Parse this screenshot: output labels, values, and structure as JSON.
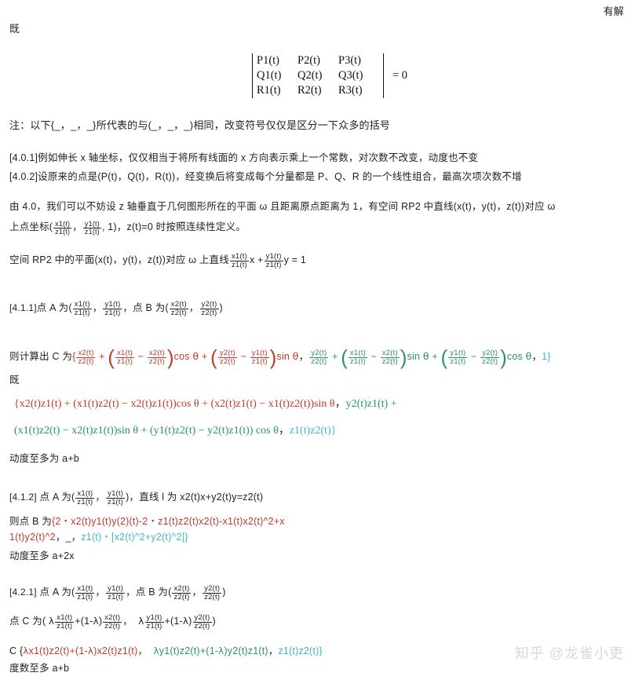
{
  "document": {
    "top_right_note": "有解",
    "left_note_1": "既",
    "left_note_2": "既"
  },
  "determinant": {
    "rows": [
      [
        "P1(t)",
        "P2(t)",
        "P3(t)"
      ],
      [
        "Q1(t)",
        "Q2(t)",
        "Q3(t)"
      ],
      [
        "R1(t)",
        "R2(t)",
        "R3(t)"
      ]
    ],
    "equals": "= 0"
  },
  "paragraphs": {
    "note_brackets": "注：以下{_，_，_}所代表的与(_，_，_)相同，改变符号仅仅是区分一下众多的括号",
    "item_401": "[4.0.1]例如伸长 x 轴坐标，仅仅相当于将所有线面的 x 方向表示乘上一个常数，对次数不改变，动度也不变",
    "item_402": "[4.0.2]设原来的点是(P(t)，Q(t)，R(t))，经变换后将变成每个分量都是 P、Q、R 的一个线性组合，最高次项次数不增",
    "para_40_line1_a": "由 4.0，我们可以不妨设 z 轴垂直于几何图形所在的平面 ω 且距离原点距离为 1，有空间 RP2 中直线(x(t)，y(t)，z(t))对应 ω",
    "para_40_line2_a": "上点坐标(",
    "para_40_line2_b": "，",
    "para_40_line2_c": ", 1)，z(t)=0 时按照连续性定义。",
    "plane_line_a": "空间 RP2 中的平面(x(t)，y(t)，z(t))对应 ω 上直线",
    "plane_line_b": "x +",
    "plane_line_c": "y = 1"
  },
  "section_411": {
    "tag": "[4.1.1]",
    "point_a_label": "点 A 为(",
    "comma": "，",
    "point_b_label": "，点 B 为(",
    "close": ")",
    "frac_x1z1": {
      "num": "x1(t)",
      "den": "z1(t)"
    },
    "frac_y1z1": {
      "num": "y1(t)",
      "den": "z1(t)"
    },
    "frac_x2z2": {
      "num": "x2(t)",
      "den": "z2(t)"
    },
    "frac_y2z2": {
      "num": "y2(t)",
      "den": "z2(t)"
    },
    "result_prefix": "则计算出 C 为",
    "brace_open": "{",
    "minus": "−",
    "plus": "+",
    "cos": "cos",
    "sin": "sin",
    "theta": "θ",
    "comma_sep": "，",
    "tail_one": "1}",
    "below_note": "既"
  },
  "expanded_411": {
    "line1": "{x2(t)z1(t) + (x1(t)z2(t) − x2(t)z1(t))cos θ + (x2(t)z1(t) − x1(t)z2(t))sin θ",
    "line1_green": "y2(t)z1(t) +",
    "line2_green": "(x1(t)z2(t) − x2(t)z1(t))sin θ + (y1(t)z2(t) − y2(t)z1(t)) cos θ",
    "line2_teal": "z1(t)z2(t)}",
    "degree_note": "动度至多为 a+b"
  },
  "section_412": {
    "tag": "[4.1.2]",
    "point_a_label": "点 A 为(",
    "comma": "，",
    "line_label": "，直线 l 为 x2(t)x+y2(t)y=z2(t)",
    "point_b_prefix": "则点 B 为",
    "b_red_line1": "{2・x2(t)y1(t)y(2)(t)-2・z1(t)z2(t)x2(t)-x1(t)x2(t)^2+x",
    "b_red_line2": "1(t)y2(t)^2",
    "b_sep1": "，_，",
    "b_teal": "z1(t)・[x2(t)^2+y2(t)^2]}",
    "degree_note": "动度至多 a+2x"
  },
  "section_421": {
    "tag": "[4.2.1]",
    "point_a_label": "点 A 为(",
    "comma": "，",
    "point_b_label": "，点 B 为(",
    "close": ")",
    "point_c_prefix": "点 C 为(",
    "lambda": "λ",
    "one_minus_lambda": "+(1-",
    "lambda_close": ")",
    "c_expanded_prefix": "C {",
    "c_red": "x1(t)z2(t)+(1-",
    "c_red_tail": ")x2(t)z1(t)",
    "c_green": "y1(t)z2(t)+(1-",
    "c_green_tail": ")y2(t)z1(t)",
    "c_teal": "z1(t)z2(t)}",
    "comma_sep": "，",
    "degree_note": "度数至多 a+b"
  },
  "watermark": {
    "text": "知乎 @龙雀小吏"
  },
  "colors": {
    "red": "#c0392b",
    "green": "#27955f",
    "teal": "#41b6cf",
    "black": "#1a1a1a",
    "watermark": "#d9d9d9"
  }
}
